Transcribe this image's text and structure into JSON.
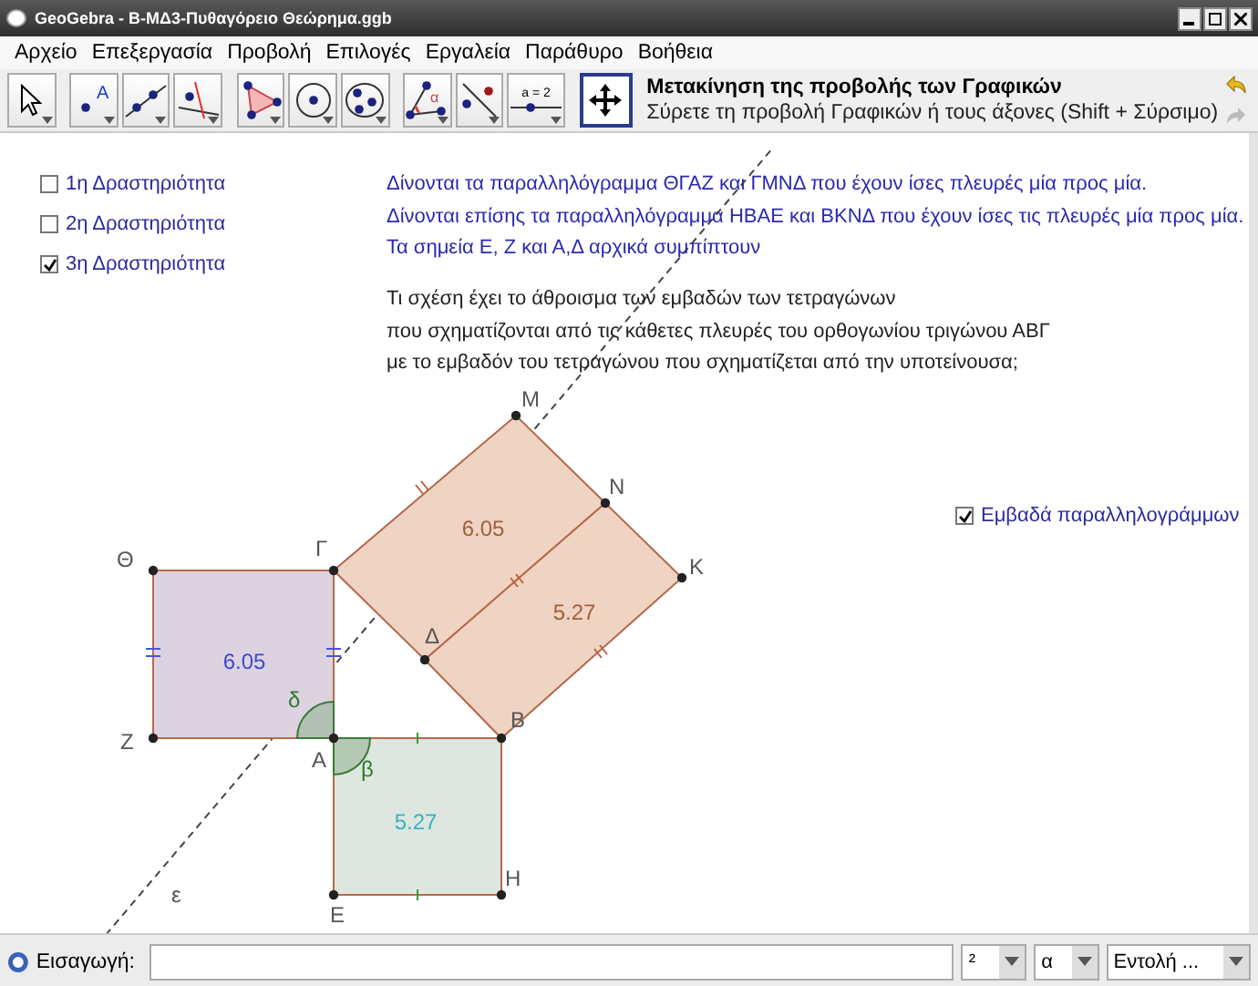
{
  "window": {
    "title": "GeoGebra - B-ΜΔ3-Πυθαγόρειο Θεώρημα.ggb"
  },
  "menu": [
    "Αρχείο",
    "Επεξεργασία",
    "Προβολή",
    "Επιλογές",
    "Εργαλεία",
    "Παράθυρο",
    "Βοήθεια"
  ],
  "tools": [
    {
      "kind": "move",
      "selected": false
    },
    {
      "kind": "point",
      "icon_text": "A",
      "selected": false
    },
    {
      "kind": "line",
      "selected": false
    },
    {
      "kind": "perpendicular",
      "selected": false
    },
    {
      "kind": "polygon",
      "selected": false
    },
    {
      "kind": "circle",
      "selected": false
    },
    {
      "kind": "conic",
      "selected": false
    },
    {
      "kind": "angle",
      "icon_text": "α",
      "selected": false
    },
    {
      "kind": "reflect",
      "selected": false
    },
    {
      "kind": "slider",
      "icon_text": "a = 2",
      "selected": false
    },
    {
      "kind": "pan",
      "selected": true
    }
  ],
  "tool_help": {
    "title": "Μετακίνηση της προβολής των Γραφικών",
    "description": "Σύρετε τη προβολή Γραφικών ή τους άξονες (Shift + Σύρσιμο)"
  },
  "activities": [
    {
      "label": "1η Δραστηριότητα",
      "checked": false
    },
    {
      "label": "2η Δραστηριότητα",
      "checked": false
    },
    {
      "label": "3η Δραστηριότητα",
      "checked": true
    }
  ],
  "instructions": [
    "Δίνονται τα παραλληλόγραμμα ΘΓΑΖ και ΓΜΝΔ που έχουν ίσες πλευρές μία προς μία.",
    "Δίνονται επίσης τα παραλληλόγραμμα ΗΒΑΕ και ΒΚΝΔ που έχουν ίσες τις πλευρές μία προς μία.",
    "Τα σημεία Ε, Ζ και Α,Δ αρχικά συμπίπτουν"
  ],
  "question": [
    "Τι σχέση έχει το άθροισμα των εμβαδών των τετραγώνων",
    "που σχηματίζονται από τις κάθετες πλευρές του ορθογωνίου τριγώνου ΑΒΓ",
    "με το εμβαδόν του τετραγώνου που σχηματίζεται από την υποτείνουσα;"
  ],
  "areas_toggle": {
    "label": "Εμβαδά παραλληλογράμμων",
    "checked": true
  },
  "figure": {
    "points": [
      "Μ",
      "Ν",
      "Κ",
      "Γ",
      "Δ",
      "Β",
      "Θ",
      "Ζ",
      "Α",
      "Ε",
      "Η"
    ],
    "line_label": "ε",
    "angles": [
      "δ",
      "β"
    ],
    "areas": [
      "6.05",
      "5.27",
      "6.05",
      "5.27"
    ]
  },
  "input_bar": {
    "label": "Εισαγωγή:",
    "selectors": [
      "²",
      "α",
      "Εντολή ..."
    ]
  }
}
